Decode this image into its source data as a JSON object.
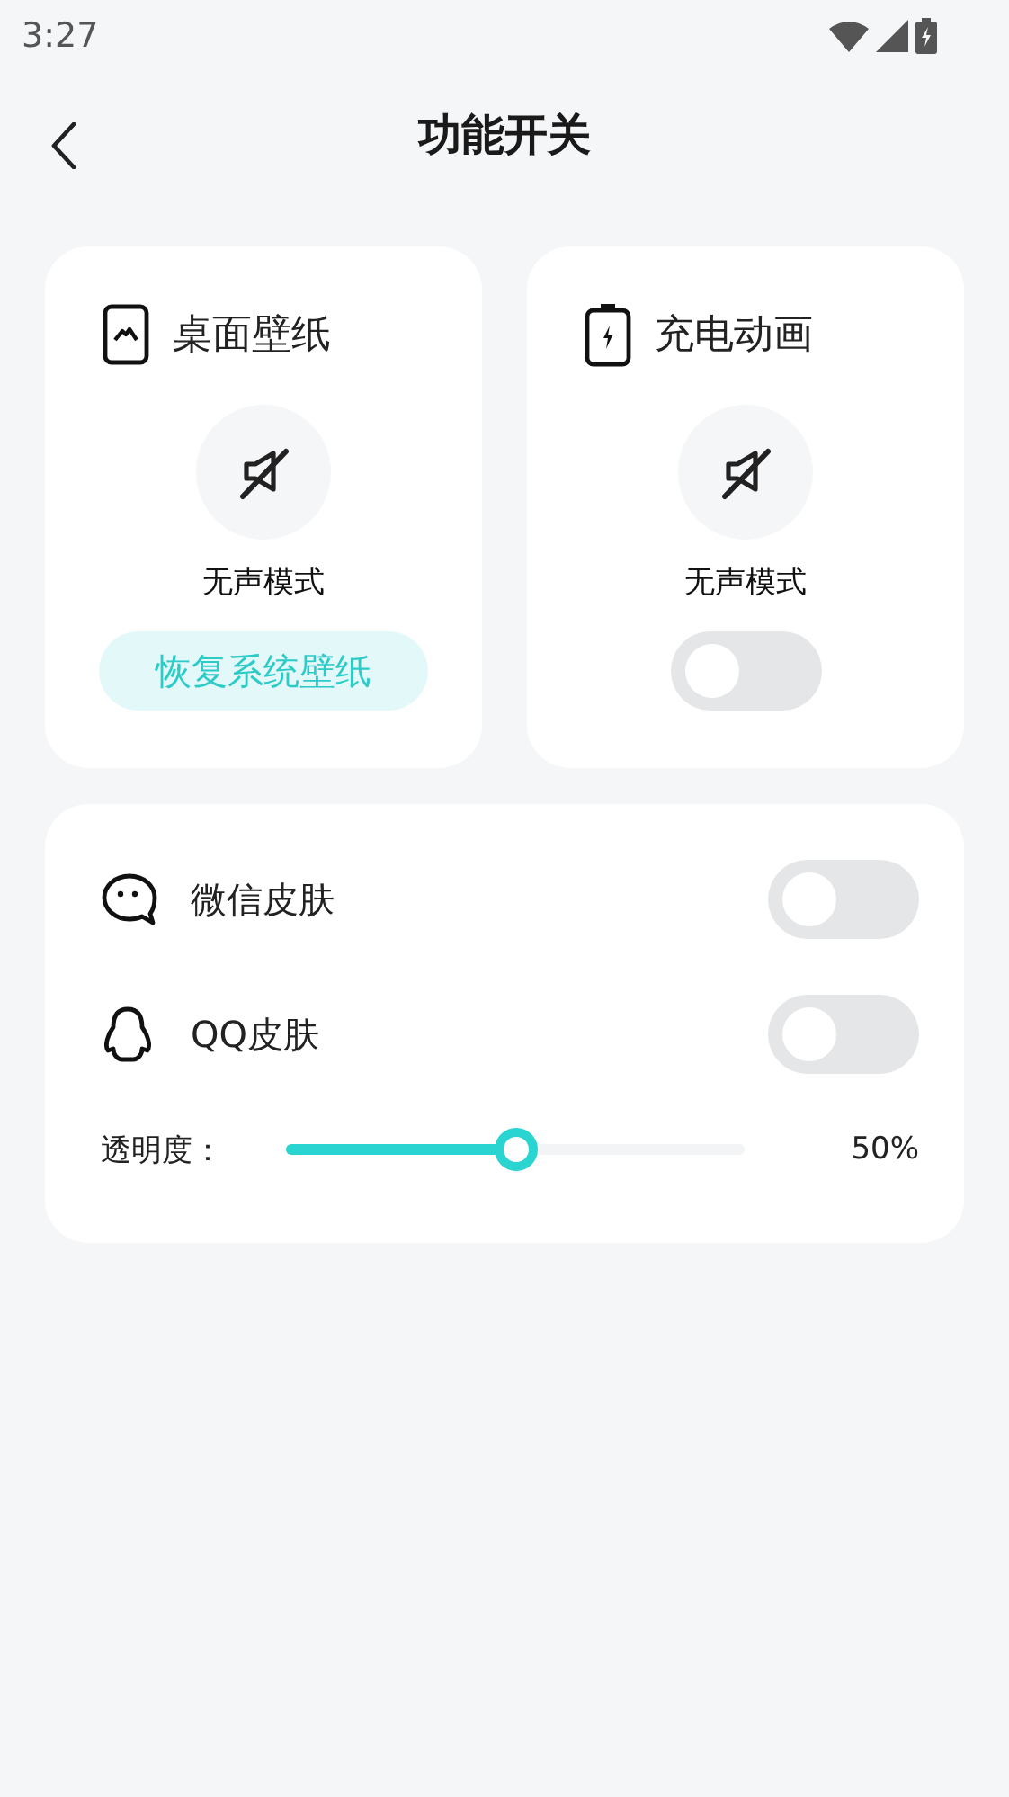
{
  "status_bar": {
    "time": "3:27"
  },
  "header": {
    "title": "功能开关"
  },
  "cards": [
    {
      "kind": "button",
      "title": "桌面壁纸",
      "mode_label": "无声模式",
      "button_label": "恢复系统壁纸"
    },
    {
      "kind": "toggle",
      "title": "充电动画",
      "mode_label": "无声模式",
      "on": false
    }
  ],
  "skins": {
    "items": [
      {
        "label": "微信皮肤",
        "on": false
      },
      {
        "label": "QQ皮肤",
        "on": false
      }
    ],
    "opacity": {
      "label": "透明度：",
      "level": 0.5,
      "reading": "50%"
    }
  }
}
